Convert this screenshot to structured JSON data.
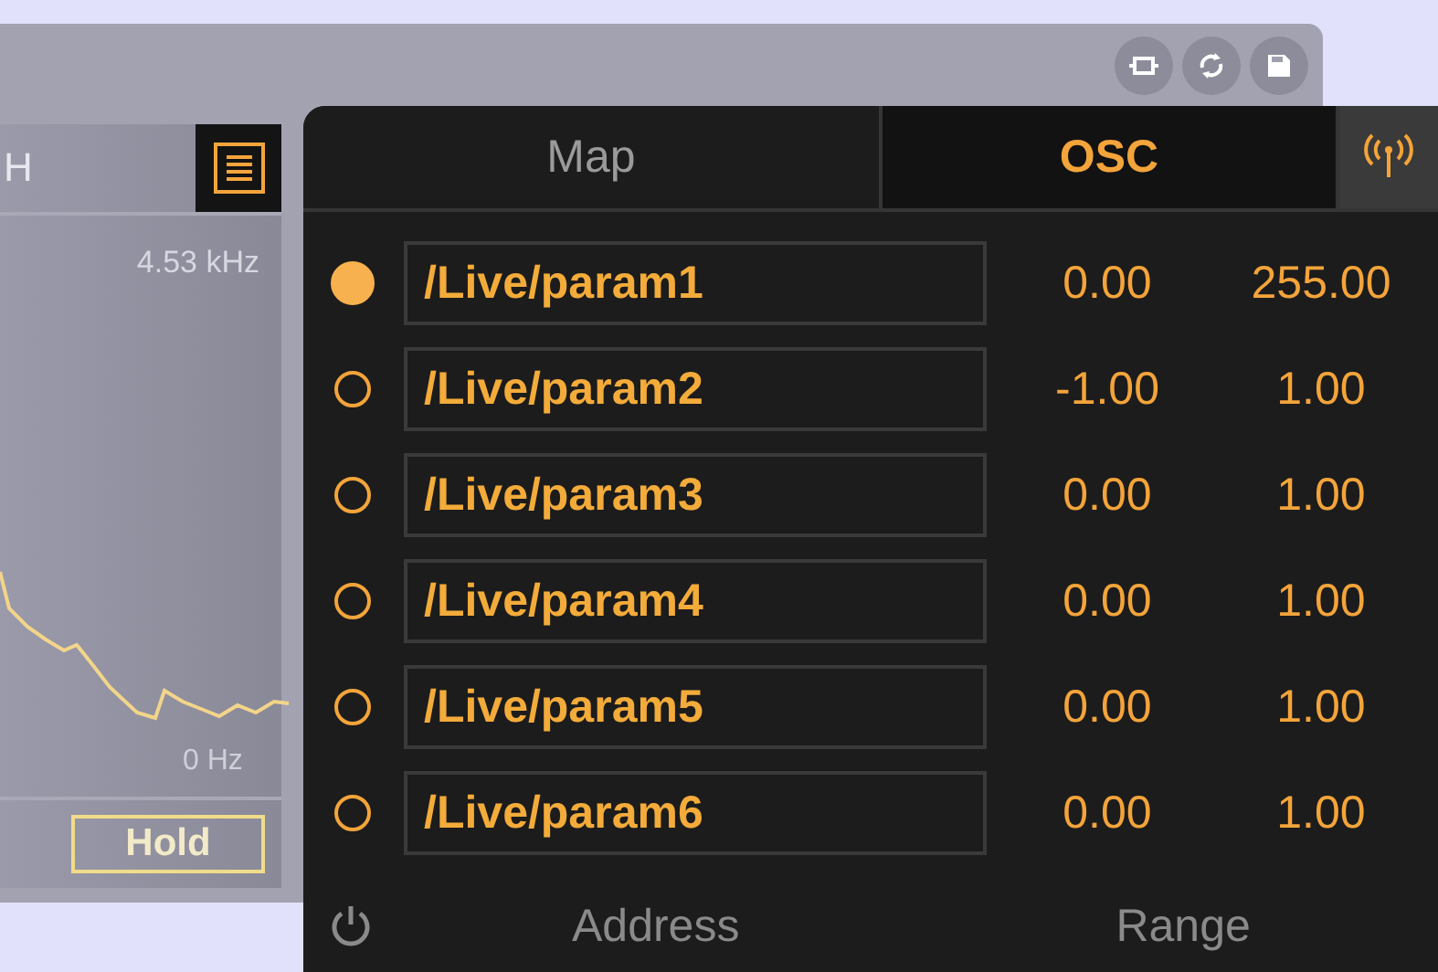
{
  "spectrum": {
    "title": "H",
    "freq_max": "4.53 kHz",
    "freq_min": "0 Hz",
    "hold_button": "Hold"
  },
  "osc_panel": {
    "tabs": [
      {
        "label": "Map",
        "selected": false
      },
      {
        "label": "OSC",
        "selected": true
      }
    ],
    "rows": [
      {
        "selected": true,
        "address": "/Live/param1",
        "min": "0.00",
        "max": "255.00"
      },
      {
        "selected": false,
        "address": "/Live/param2",
        "min": "-1.00",
        "max": "1.00"
      },
      {
        "selected": false,
        "address": "/Live/param3",
        "min": "0.00",
        "max": "1.00"
      },
      {
        "selected": false,
        "address": "/Live/param4",
        "min": "0.00",
        "max": "1.00"
      },
      {
        "selected": false,
        "address": "/Live/param5",
        "min": "0.00",
        "max": "1.00"
      },
      {
        "selected": false,
        "address": "/Live/param6",
        "min": "0.00",
        "max": "1.00"
      }
    ],
    "footer": {
      "address_label": "Address",
      "range_label": "Range"
    }
  }
}
